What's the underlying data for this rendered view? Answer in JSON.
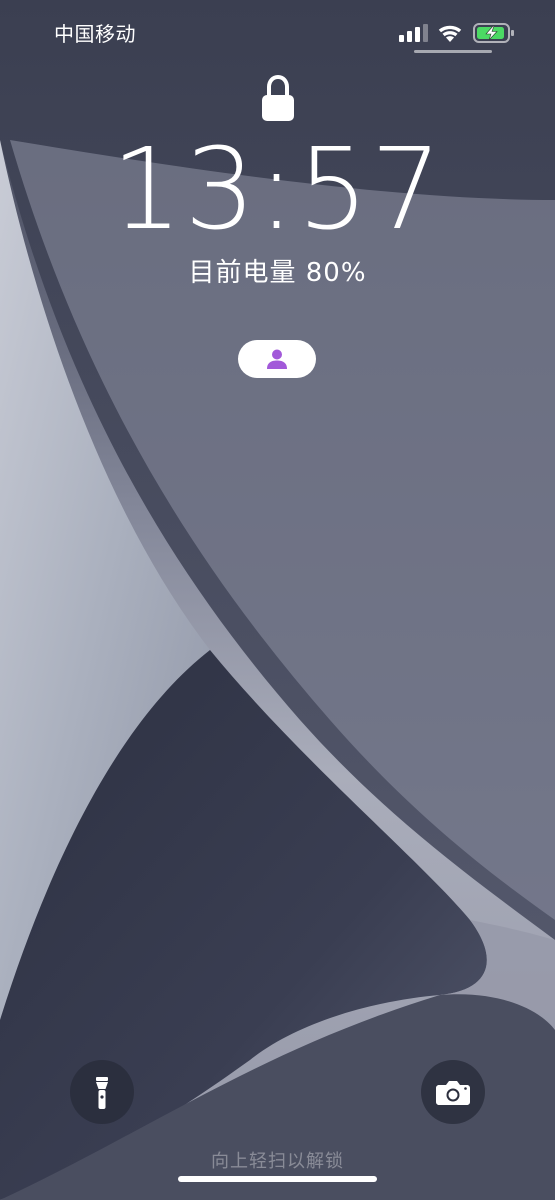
{
  "status_bar": {
    "carrier": "中国移动",
    "signal_bars_active": 3,
    "signal_bars_total": 4,
    "battery_level": 0.8,
    "battery_charging": true,
    "battery_color": "#4cd964"
  },
  "lock_screen": {
    "time": "13:57",
    "battery_status": "目前电量 80%",
    "owner_icon_color": "#a259d9"
  },
  "controls": {
    "flashlight_icon": "flashlight-icon",
    "camera_icon": "camera-icon"
  },
  "footer": {
    "swipe_hint": "向上轻扫以解锁"
  }
}
